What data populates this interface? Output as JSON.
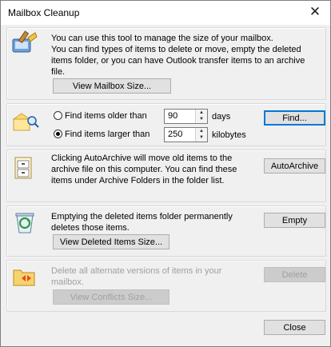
{
  "window": {
    "title": "Mailbox Cleanup",
    "close_glyph": "✕"
  },
  "intro": {
    "line1": "You can use this tool to manage the size of your mailbox.",
    "line2": "You can find types of items to delete or move, empty the deleted items folder, or you can have Outlook transfer items to an archive file.",
    "view_size_label": "View Mailbox Size..."
  },
  "find": {
    "older_label": "Find items older than",
    "older_value": "90",
    "older_unit": "days",
    "larger_label": "Find items larger than",
    "larger_value": "250",
    "larger_unit": "kilobytes",
    "selected": "larger",
    "find_label": "Find..."
  },
  "archive": {
    "description": "Clicking AutoArchive will move old items to the archive file on this computer. You can find these items under Archive Folders in the folder list.",
    "button_label": "AutoArchive"
  },
  "deleted": {
    "description": "Emptying the deleted items folder permanently deletes those items.",
    "empty_label": "Empty",
    "view_label": "View Deleted Items Size..."
  },
  "conflicts": {
    "description": "Delete all alternate versions of items in your mailbox.",
    "delete_label": "Delete",
    "view_label": "View Conflicts Size..."
  },
  "footer": {
    "close_label": "Close"
  },
  "colors": {
    "focus_blue": "#0078d7",
    "disabled_text": "#a0a0a0"
  },
  "icons": [
    "broom-mailbox-icon",
    "find-items-icon",
    "archive-cabinet-icon",
    "recycle-bin-icon",
    "conflict-folder-icon"
  ]
}
